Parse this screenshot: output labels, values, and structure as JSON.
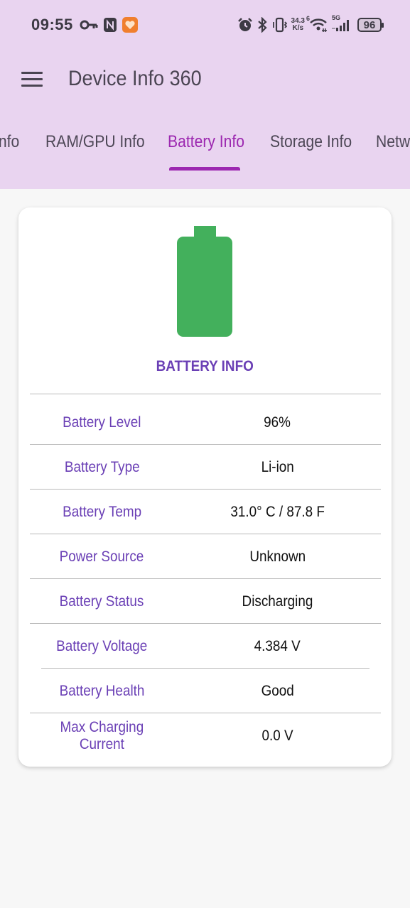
{
  "status_bar": {
    "time": "09:55",
    "left_icons": [
      "vpn-key-icon",
      "nfc-icon",
      "app-notification-icon"
    ],
    "right_icons": [
      "alarm-icon",
      "bluetooth-icon",
      "vibrate-icon",
      "wifi-6-icon",
      "signal-5g-icon"
    ],
    "net_speed_value": "34.3",
    "net_speed_unit": "K/s",
    "wifi_badge": "6",
    "network_type": "5G",
    "battery_percent": "96"
  },
  "app_bar": {
    "title": "Device Info 360",
    "menu_icon": "hamburger-menu-icon"
  },
  "tabs": [
    {
      "label": "Info",
      "active": false
    },
    {
      "label": "RAM/GPU Info",
      "active": false
    },
    {
      "label": "Battery Info",
      "active": true
    },
    {
      "label": "Storage Info",
      "active": false
    },
    {
      "label": "Netw",
      "active": false
    }
  ],
  "colors": {
    "app_bar_bg": "#e9d4f0",
    "accent": "#9c27b0",
    "label_color": "#6a3fb5",
    "battery_green": "#43b05c"
  },
  "card": {
    "icon": "battery-full-icon",
    "title": "BATTERY INFO",
    "rows": [
      {
        "label": "Battery Level",
        "value": "96%"
      },
      {
        "label": "Battery Type",
        "value": "Li-ion"
      },
      {
        "label": "Battery Temp",
        "value": "31.0° C / 87.8 F"
      },
      {
        "label": "Power Source",
        "value": "Unknown"
      },
      {
        "label": "Battery Status",
        "value": "Discharging"
      },
      {
        "label": "Battery Voltage",
        "value": "4.384 V"
      },
      {
        "label": "Battery Health",
        "value": "Good"
      },
      {
        "label": "Max Charging Current",
        "value": "0.0 V"
      }
    ]
  }
}
